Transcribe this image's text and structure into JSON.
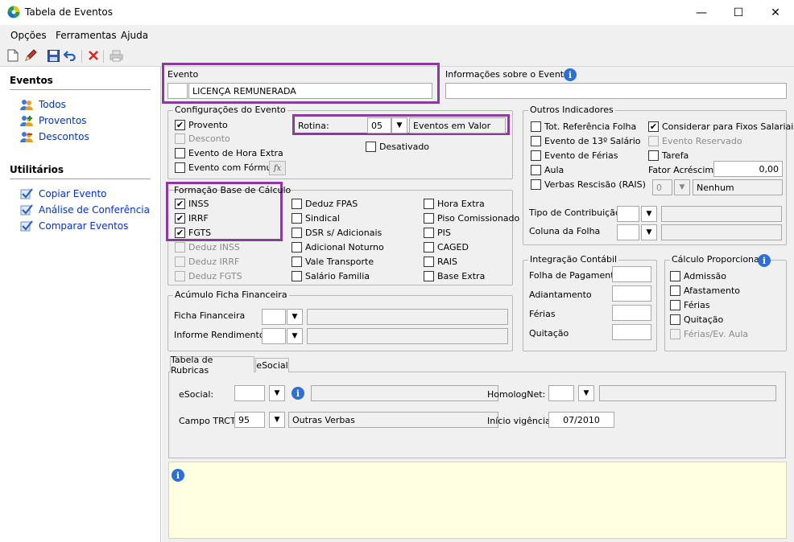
{
  "window": {
    "title": "Tabela de Eventos",
    "minimize": "—",
    "maximize": "☐",
    "close": "✕"
  },
  "menu": [
    "Opções",
    "Ferramentas",
    "Ajuda"
  ],
  "sidebar": {
    "eventos_header": "Eventos",
    "eventos": [
      "Todos",
      "Proventos",
      "Descontos"
    ],
    "utilitarios_header": "Utilitários",
    "utilitarios": [
      "Copiar Evento",
      "Análise de Conferência",
      "Comparar Eventos"
    ]
  },
  "evento": {
    "label": "Evento",
    "code": "",
    "name": "LICENÇA REMUNERADA"
  },
  "informacoes": {
    "label": "Informações sobre o Evento",
    "value": ""
  },
  "config": {
    "title": "Configurações do Evento",
    "provento": "Provento",
    "desconto": "Desconto",
    "hora_extra": "Evento de Hora Extra",
    "formula": "Evento com Fórmula",
    "rotina_label": "Rotina:",
    "rotina_value": "05",
    "rotina_desc": "Eventos em Valor",
    "desativado": "Desativado"
  },
  "formacao": {
    "title": "Formação Base de Cálculo",
    "col1": [
      {
        "label": "INSS",
        "checked": true,
        "disabled": false
      },
      {
        "label": "IRRF",
        "checked": true,
        "disabled": false
      },
      {
        "label": "FGTS",
        "checked": true,
        "disabled": false
      },
      {
        "label": "Deduz INSS",
        "checked": false,
        "disabled": true
      },
      {
        "label": "Deduz IRRF",
        "checked": false,
        "disabled": true
      },
      {
        "label": "Deduz FGTS",
        "checked": false,
        "disabled": true
      }
    ],
    "col2": [
      "Deduz FPAS",
      "Sindical",
      "DSR s/ Adicionais",
      "Adicional Noturno",
      "Vale Transporte",
      "Salário Familia"
    ],
    "col3": [
      "Hora Extra",
      "Piso Comissionado",
      "PIS",
      "CAGED",
      "RAIS",
      "Base Extra"
    ]
  },
  "acumulo": {
    "title": "Acúmulo Ficha Financeira",
    "ficha": "Ficha Financeira",
    "informe": "Informe Rendimentos"
  },
  "outros": {
    "title": "Outros Indicadores",
    "left": [
      "Tot. Referência Folha",
      "Evento de 13º Salário",
      "Evento de Férias",
      "Aula",
      "Verbas Rescisão (RAIS)"
    ],
    "considerar": "Considerar para Fixos Salariais",
    "reservado": "Evento Reservado",
    "tarefa": "Tarefa",
    "fator_label": "Fator Acréscimo",
    "fator_value": "0,00",
    "rais_value": "0",
    "rais_desc": "Nenhum",
    "tipo_contrib": "Tipo de Contribuição",
    "coluna_folha": "Coluna da Folha"
  },
  "integracao": {
    "title": "Integração Contábil",
    "items": [
      "Folha de Pagamento",
      "Adiantamento",
      "Férias",
      "Quitação"
    ]
  },
  "proporcional": {
    "title": "Cálculo Proporcional",
    "items": [
      "Admissão",
      "Afastamento",
      "Férias",
      "Quitação",
      "Férias/Ev. Aula"
    ]
  },
  "tabs": [
    "Tabela de Rubricas",
    "eSocial"
  ],
  "rubricas": {
    "esocial_label": "eSocial:",
    "homolog_label": "HomologNet:",
    "trct_label": "Campo TRCT:",
    "trct_value": "95",
    "trct_desc": "Outras Verbas",
    "vigencia_label": "Início vigência:",
    "vigencia_value": "07/2010"
  },
  "icons": {
    "info": "i",
    "check": "✔",
    "dropdown": "▼",
    "fx": "fx"
  },
  "colors": {
    "highlight": "#8b3a9e",
    "link": "#0033cc",
    "note": "#ffffe1"
  }
}
